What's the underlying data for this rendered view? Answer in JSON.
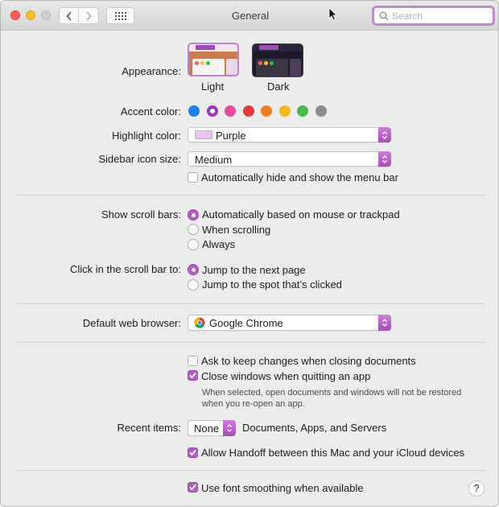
{
  "window": {
    "title": "General"
  },
  "toolbar": {
    "search_placeholder": "Search",
    "icons": {
      "back": "chevron-left-icon",
      "forward": "chevron-right-icon",
      "show_all": "grid-icon"
    }
  },
  "appearance": {
    "label": "Appearance:",
    "options": [
      {
        "label": "Light",
        "selected": true
      },
      {
        "label": "Dark",
        "selected": false
      }
    ]
  },
  "accent_color": {
    "label": "Accent color:",
    "colors": [
      "#1f7cf2",
      "#9b3bb0",
      "#e84c9d",
      "#e23b3b",
      "#f27b1f",
      "#f5b820",
      "#4cb84c",
      "#8c8c8c"
    ],
    "selected_index": 1
  },
  "highlight_color": {
    "label": "Highlight color:",
    "value": "Purple",
    "swatch": "#e3c6e9"
  },
  "sidebar_icon_size": {
    "label": "Sidebar icon size:",
    "value": "Medium"
  },
  "menu_bar": {
    "label": "Automatically hide and show the menu bar",
    "checked": false
  },
  "scroll_bars": {
    "label": "Show scroll bars:",
    "options": [
      {
        "label": "Automatically based on mouse or trackpad",
        "checked": true
      },
      {
        "label": "When scrolling",
        "checked": false
      },
      {
        "label": "Always",
        "checked": false
      }
    ]
  },
  "scroll_click": {
    "label": "Click in the scroll bar to:",
    "options": [
      {
        "label": "Jump to the next page",
        "checked": true
      },
      {
        "label": "Jump to the spot that’s clicked",
        "checked": false
      }
    ]
  },
  "browser": {
    "label": "Default web browser:",
    "value": "Google Chrome"
  },
  "documents": {
    "ask_keep": {
      "label": "Ask to keep changes when closing documents",
      "checked": false
    },
    "close_windows": {
      "label": "Close windows when quitting an app",
      "checked": true
    },
    "note_line1": "When selected, open documents and windows will not be restored",
    "note_line2": "when you re-open an app."
  },
  "recent_items": {
    "label": "Recent items:",
    "value": "None",
    "suffix": "Documents, Apps, and Servers"
  },
  "handoff": {
    "label": "Allow Handoff between this Mac and your iCloud devices",
    "checked": true
  },
  "font_smoothing": {
    "label": "Use font smoothing when available",
    "checked": true
  },
  "help": {
    "label": "?"
  },
  "colors": {
    "accent": "#b25ec0",
    "search_focus": "#c288cf"
  }
}
